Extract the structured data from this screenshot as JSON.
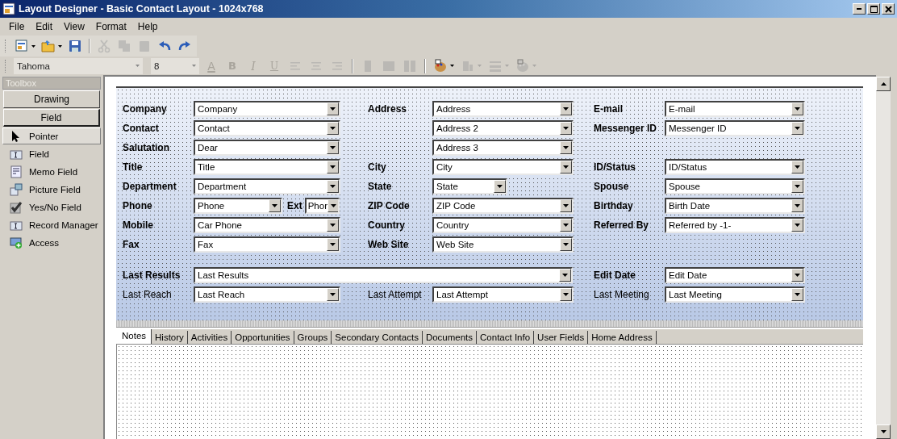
{
  "window": {
    "title": "Layout Designer - Basic Contact Layout - 1024x768"
  },
  "menu": [
    {
      "label": "File"
    },
    {
      "label": "Edit"
    },
    {
      "label": "View"
    },
    {
      "label": "Format"
    },
    {
      "label": "Help"
    }
  ],
  "toolbar": [
    {
      "kind": "new",
      "disabled": false,
      "dropdown": true
    },
    {
      "kind": "open",
      "disabled": false,
      "dropdown": true
    },
    {
      "kind": "save",
      "disabled": false,
      "dropdown": false
    },
    {
      "kind": "cut",
      "disabled": true,
      "dropdown": false
    },
    {
      "kind": "copy",
      "disabled": true,
      "dropdown": false
    },
    {
      "kind": "paste",
      "disabled": true,
      "dropdown": false
    },
    {
      "kind": "undo",
      "disabled": false,
      "dropdown": false
    },
    {
      "kind": "redo",
      "disabled": false,
      "dropdown": false
    }
  ],
  "format_bar": {
    "font": "Tahoma",
    "size": "8",
    "buttons": [
      {
        "kind": "color",
        "text": "A",
        "disabled": true
      },
      {
        "kind": "bold",
        "text": "B",
        "disabled": true
      },
      {
        "kind": "italic",
        "text": "I",
        "disabled": true
      },
      {
        "kind": "underline",
        "text": "U",
        "disabled": true
      },
      {
        "kind": "left",
        "disabled": true
      },
      {
        "kind": "center",
        "disabled": true
      },
      {
        "kind": "right",
        "disabled": true
      },
      {
        "kind": "col1",
        "disabled": true
      },
      {
        "kind": "col2",
        "disabled": true
      },
      {
        "kind": "col3",
        "disabled": true
      },
      {
        "kind": "palette",
        "disabled": false
      },
      {
        "kind": "align",
        "disabled": true
      },
      {
        "kind": "lines",
        "disabled": true
      },
      {
        "kind": "palette",
        "disabled": true
      }
    ]
  },
  "toolbox": {
    "title": "Toolbox",
    "buttons": [
      {
        "label": "Drawing",
        "selected": false
      },
      {
        "label": "Field",
        "selected": true
      }
    ],
    "items": [
      {
        "label": "Pointer",
        "kind": "pointer",
        "selected": true
      },
      {
        "label": "Field",
        "kind": "field",
        "selected": false
      },
      {
        "label": "Memo Field",
        "kind": "memo",
        "selected": false
      },
      {
        "label": "Picture Field",
        "kind": "picture",
        "selected": false
      },
      {
        "label": "Yes/No Field",
        "kind": "yesno",
        "selected": false
      },
      {
        "label": "Record Manager",
        "kind": "field",
        "selected": false
      },
      {
        "label": "Access",
        "kind": "access",
        "selected": false
      }
    ]
  },
  "form": {
    "groups": [
      {
        "rows": [
          {
            "cells": [
              {
                "kind": "field",
                "label": "Company",
                "bold": true,
                "value": "Company"
              },
              {
                "kind": "field",
                "label": "Address",
                "bold": true,
                "value": "Address"
              },
              {
                "kind": "field",
                "label": "E-mail",
                "bold": true,
                "value": "E-mail"
              }
            ]
          },
          {
            "cells": [
              {
                "kind": "field",
                "label": "Contact",
                "bold": true,
                "value": "Contact"
              },
              {
                "kind": "field",
                "value": "Address 2"
              },
              {
                "kind": "field",
                "label": "Messenger ID",
                "bold": true,
                "value": "Messenger ID"
              }
            ]
          },
          {
            "cells": [
              {
                "kind": "field",
                "label": "Salutation",
                "bold": true,
                "value": "Dear"
              },
              {
                "kind": "field",
                "value": "Address 3"
              },
              ""
            ]
          },
          {
            "cells": [
              {
                "kind": "field",
                "label": "Title",
                "bold": true,
                "value": "Title"
              },
              {
                "kind": "field",
                "label": "City",
                "bold": true,
                "value": "City"
              },
              {
                "kind": "field",
                "label": "ID/Status",
                "bold": true,
                "value": "ID/Status"
              }
            ]
          },
          {
            "cells": [
              {
                "kind": "field",
                "label": "Department",
                "bold": true,
                "value": "Department"
              },
              {
                "kind": "short",
                "label": "State",
                "bold": true,
                "value": "State"
              },
              {
                "kind": "field",
                "label": "Spouse",
                "bold": true,
                "value": "Spouse"
              }
            ]
          },
          {
            "cells": [
              {
                "kind": "phone",
                "label": "Phone",
                "bold": true,
                "value": "Phone",
                "ext_label": "Ext",
                "ext_value": "Phor"
              },
              {
                "kind": "field",
                "label": "ZIP Code",
                "bold": true,
                "value": "ZIP Code"
              },
              {
                "kind": "field",
                "label": "Birthday",
                "bold": true,
                "value": "Birth Date"
              }
            ]
          },
          {
            "cells": [
              {
                "kind": "field",
                "label": "Mobile",
                "bold": true,
                "value": "Car Phone"
              },
              {
                "kind": "field",
                "label": "Country",
                "bold": true,
                "value": "Country"
              },
              {
                "kind": "field",
                "label": "Referred By",
                "bold": true,
                "value": "Referred by -1-"
              }
            ]
          },
          {
            "cells": [
              {
                "kind": "field",
                "label": "Fax",
                "bold": true,
                "value": "Fax"
              },
              {
                "kind": "field",
                "label": "Web Site",
                "bold": true,
                "value": "Web Site"
              },
              ""
            ]
          }
        ]
      },
      {
        "rows": [
          {
            "cells": [
              {
                "kind": "wide",
                "label": "Last Results",
                "bold": true,
                "value": "Last Results"
              },
              "",
              {
                "kind": "field",
                "label": "Edit Date",
                "bold": true,
                "value": "Edit Date"
              }
            ]
          },
          {
            "cells": [
              {
                "kind": "field",
                "label": "Last Reach",
                "bold": false,
                "value": "Last Reach"
              },
              {
                "kind": "field",
                "label": "Last Attempt",
                "bold": false,
                "value": "Last Attempt"
              },
              {
                "kind": "field",
                "label": "Last Meeting",
                "bold": false,
                "value": "Last Meeting"
              }
            ]
          }
        ]
      }
    ]
  },
  "tabs": [
    {
      "label": "Notes",
      "selected": true
    },
    {
      "label": "History",
      "selected": false
    },
    {
      "label": "Activities",
      "selected": false
    },
    {
      "label": "Opportunities",
      "selected": false
    },
    {
      "label": "Groups",
      "selected": false
    },
    {
      "label": "Secondary Contacts",
      "selected": false
    },
    {
      "label": "Documents",
      "selected": false
    },
    {
      "label": "Contact Info",
      "selected": false
    },
    {
      "label": "User Fields",
      "selected": false
    },
    {
      "label": "Home Address",
      "selected": false
    }
  ]
}
